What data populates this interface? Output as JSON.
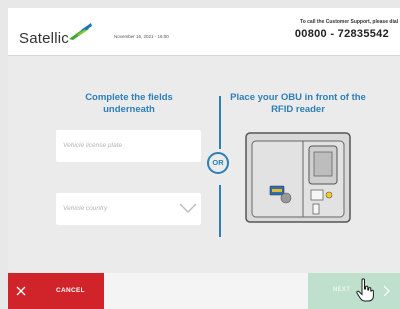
{
  "header": {
    "logo_text": "Satellic",
    "datetime": "November 16, 2021 - 16:00",
    "support_label": "To call the Customer Support, please dial",
    "support_phone": "00800 - 72835542"
  },
  "left_panel": {
    "title": "Complete the fields underneath",
    "plate_placeholder": "Vehicle license plate",
    "country_placeholder": "Vehicle country"
  },
  "separator": {
    "label": "OR"
  },
  "right_panel": {
    "title": "Place your OBU in front of the RFID reader"
  },
  "footer": {
    "cancel_label": "CANCEL",
    "next_label": "NEXT"
  },
  "colors": {
    "accent_blue": "#2d7fb8",
    "cancel_red": "#d1232a",
    "next_green_disabled": "#bfe0cd",
    "logo_green": "#3aa935",
    "logo_blue": "#1b75bc"
  },
  "icons": [
    "satellic-logo-icon",
    "chevron-down-icon",
    "close-icon",
    "chevron-right-icon",
    "rfid-reader-illustration",
    "hand-cursor-icon"
  ]
}
